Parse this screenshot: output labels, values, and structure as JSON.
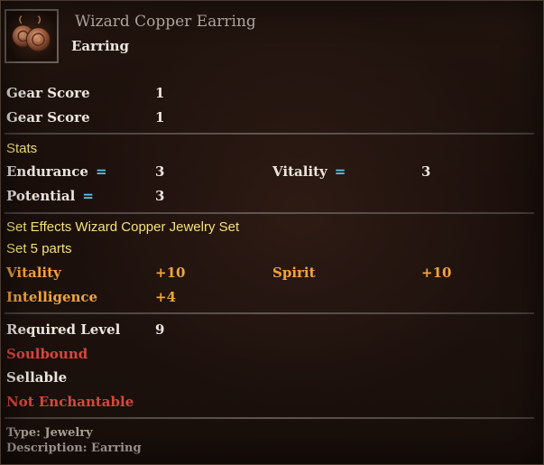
{
  "item": {
    "name": "Wizard Copper Earring",
    "type": "Earring",
    "icon": "copper-earring-icon"
  },
  "gear_scores": [
    {
      "label": "Gear Score",
      "value": "1"
    },
    {
      "label": "Gear Score",
      "value": "1"
    }
  ],
  "stats": {
    "heading": "Stats",
    "rows": [
      {
        "label": "Endurance",
        "value": "3"
      },
      {
        "label": "Vitality",
        "value": "3"
      },
      {
        "label": "Potential",
        "value": "3"
      }
    ]
  },
  "set_effects": {
    "heading": "Set Effects Wizard Copper Jewelry Set",
    "parts": "Set 5 parts",
    "bonuses": [
      {
        "label": "Vitality",
        "value": "+10"
      },
      {
        "label": "Spirit",
        "value": "+10"
      },
      {
        "label": "Intelligence",
        "value": "+4"
      }
    ]
  },
  "requirements": {
    "required_level_label": "Required Level",
    "required_level": "9",
    "soulbound": "Soulbound",
    "sellable": "Sellable",
    "enchant": "Not Enchantable"
  },
  "footer": {
    "type": "Type: Jewelry",
    "description": "Description: Earring"
  },
  "colors": {
    "title": "#b8b0a6",
    "section_heading": "#f4e27a",
    "bonus": "#f0a43a",
    "warning": "#d8473b",
    "stat_marker": "#5ec3e6"
  }
}
